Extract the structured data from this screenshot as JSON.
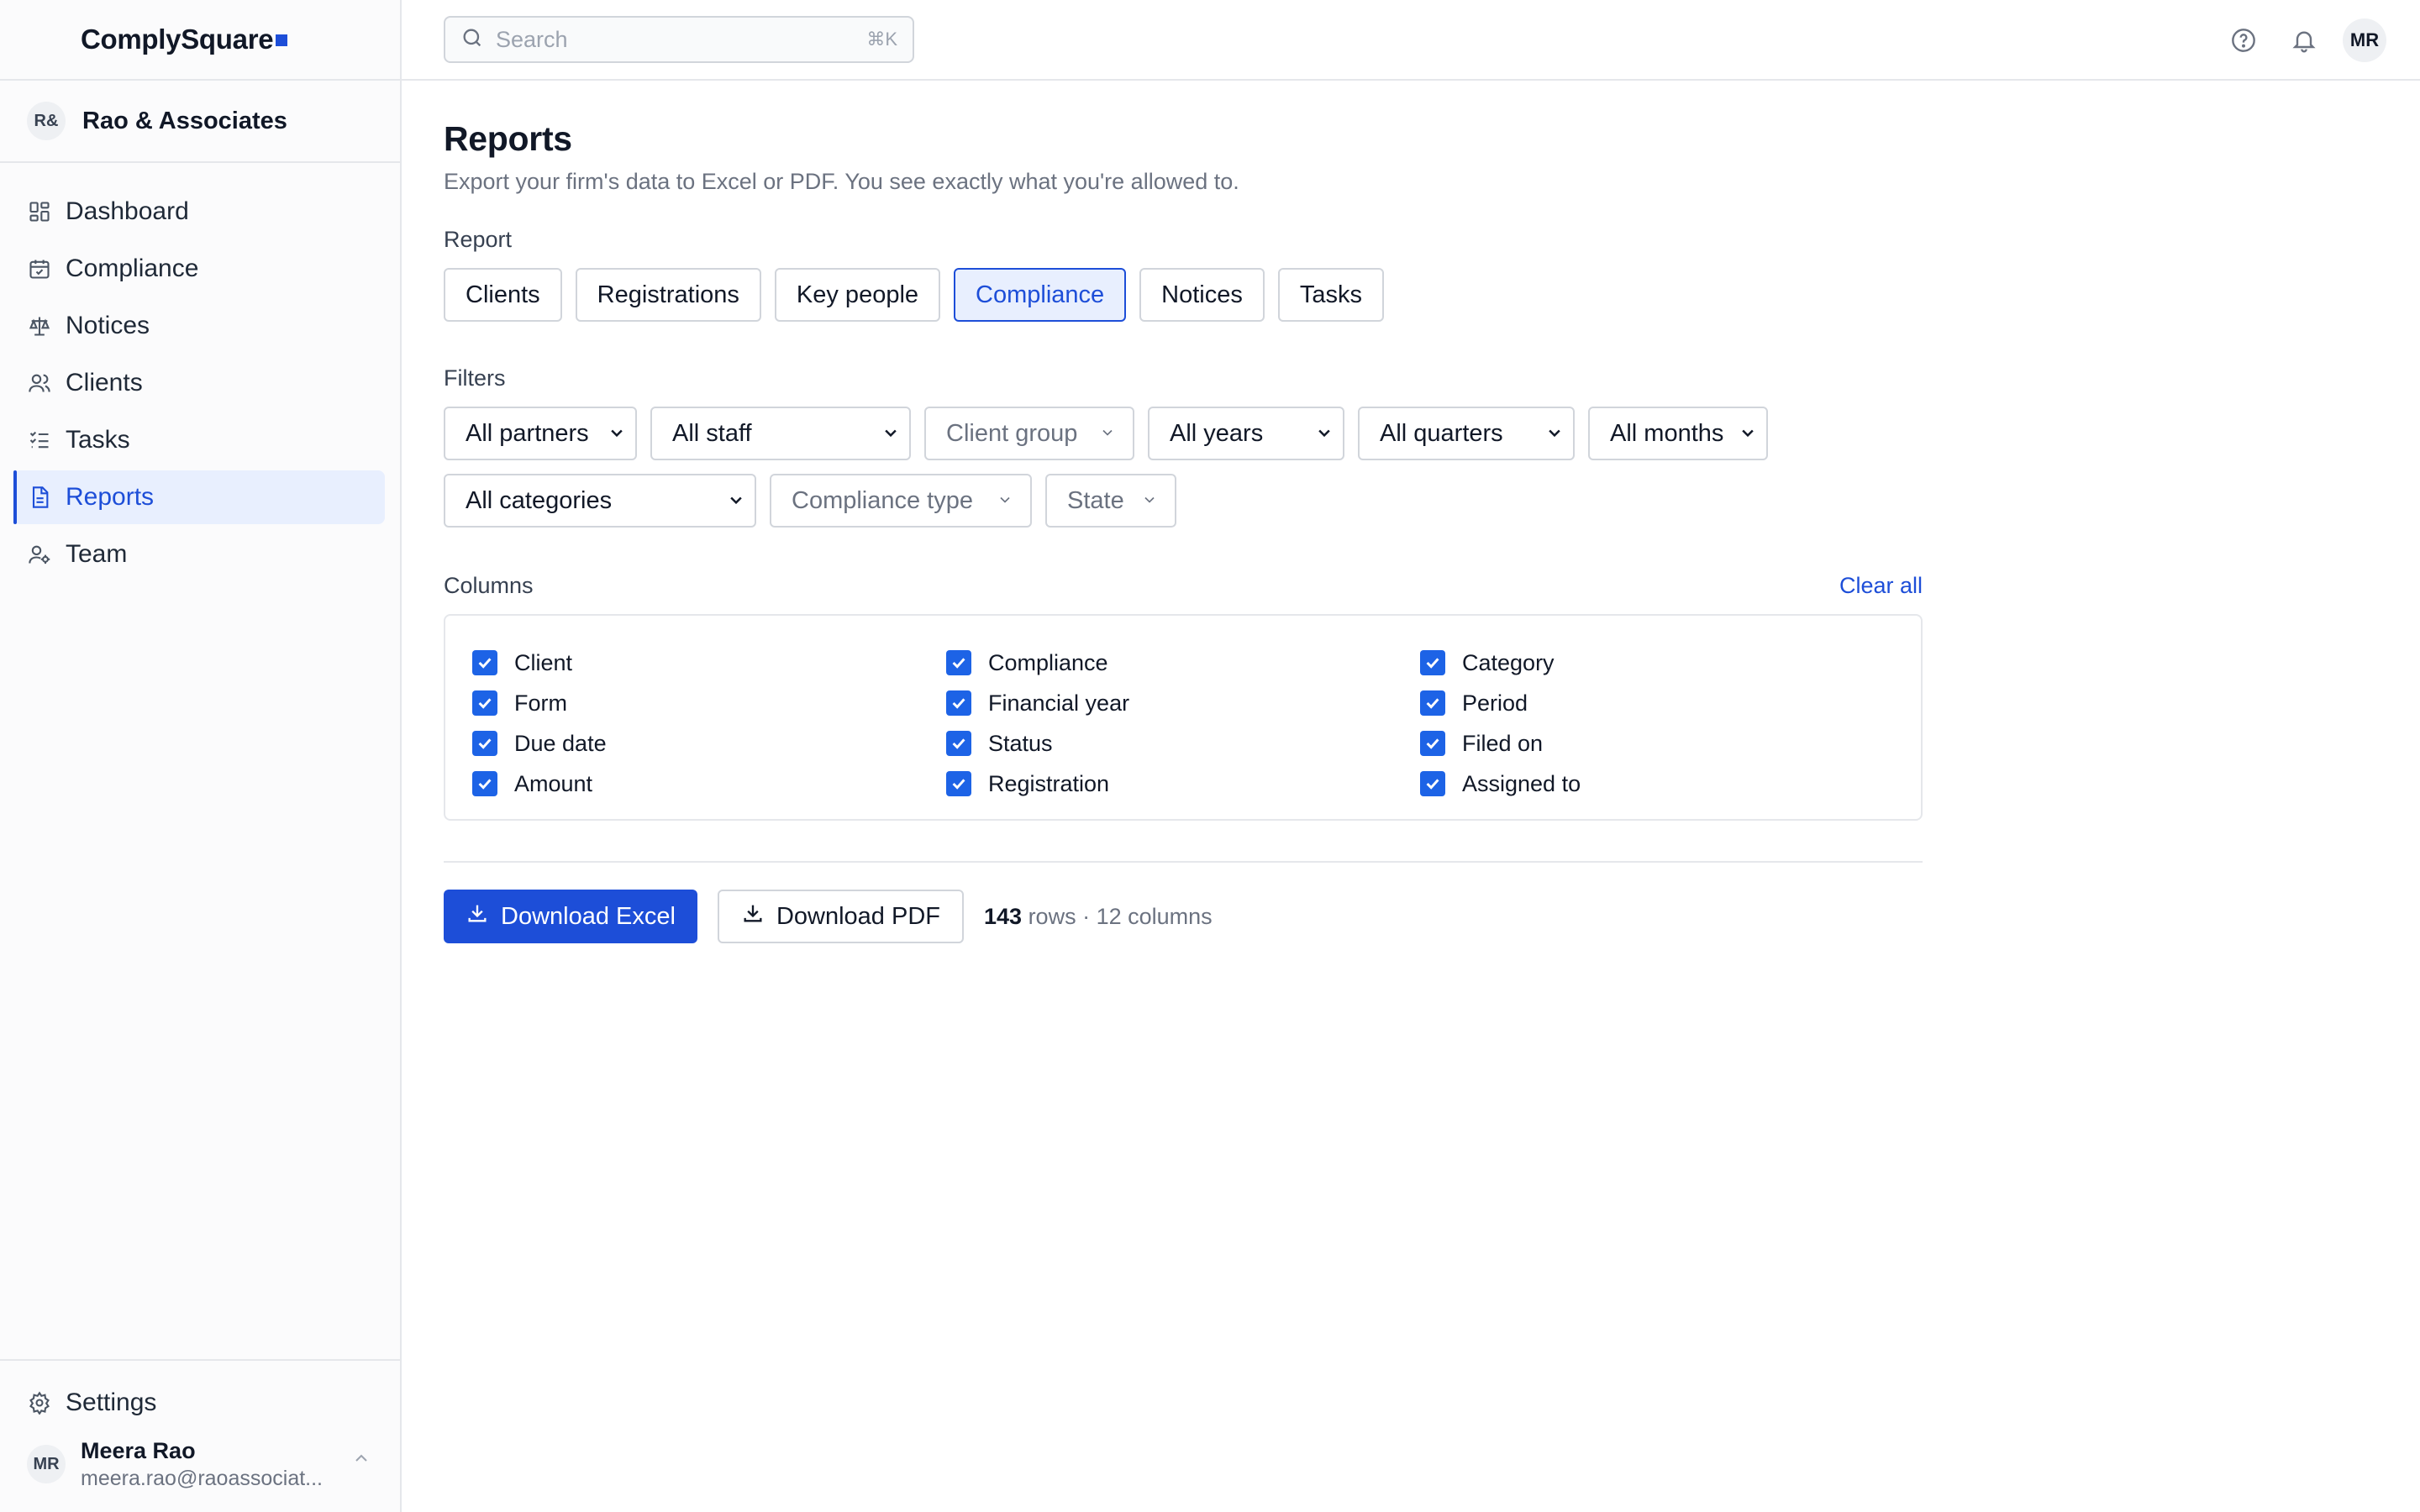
{
  "brand": {
    "name": "ComplySquare"
  },
  "org": {
    "initials": "R&",
    "name": "Rao & Associates"
  },
  "nav": [
    {
      "label": "Dashboard",
      "icon": "dashboard-icon"
    },
    {
      "label": "Compliance",
      "icon": "calendar-icon"
    },
    {
      "label": "Notices",
      "icon": "scale-icon"
    },
    {
      "label": "Clients",
      "icon": "users-icon"
    },
    {
      "label": "Tasks",
      "icon": "checklist-icon"
    },
    {
      "label": "Reports",
      "icon": "document-icon",
      "active": true
    },
    {
      "label": "Team",
      "icon": "team-icon"
    }
  ],
  "settings": {
    "label": "Settings",
    "icon": "gear-icon"
  },
  "user": {
    "initials": "MR",
    "name": "Meera Rao",
    "email": "meera.rao@raoassociat..."
  },
  "search": {
    "placeholder": "Search",
    "shortcut": "⌘K"
  },
  "topbar": {
    "avatar": "MR",
    "icons": [
      "help-icon",
      "bell-icon"
    ]
  },
  "page": {
    "title": "Reports",
    "subtitle": "Export your firm's data to Excel or PDF. You see exactly what you're allowed to."
  },
  "report": {
    "label": "Report",
    "tabs": [
      "Clients",
      "Registrations",
      "Key people",
      "Compliance",
      "Notices",
      "Tasks"
    ],
    "selected": "Compliance"
  },
  "filters": {
    "label": "Filters",
    "partners": "All partners",
    "staff": "All staff",
    "client_group": "Client group",
    "years": "All years",
    "quarters": "All quarters",
    "months": "All months",
    "categories": "All categories",
    "compliance_type": "Compliance type",
    "state": "State"
  },
  "columns": {
    "label": "Columns",
    "clear_all": "Clear all",
    "groups": [
      [
        "Client",
        "Form",
        "Due date",
        "Amount"
      ],
      [
        "Compliance",
        "Financial year",
        "Status",
        "Registration"
      ],
      [
        "Category",
        "Period",
        "Filed on",
        "Assigned to"
      ]
    ],
    "all_checked": true
  },
  "actions": {
    "excel": "Download Excel",
    "pdf": "Download PDF",
    "rows": "143",
    "rows_suffix": "rows · 12 columns"
  },
  "colors": {
    "accent": "#1d4ed8",
    "checkbox": "#1d63e6",
    "active_bg": "#e8effe"
  }
}
